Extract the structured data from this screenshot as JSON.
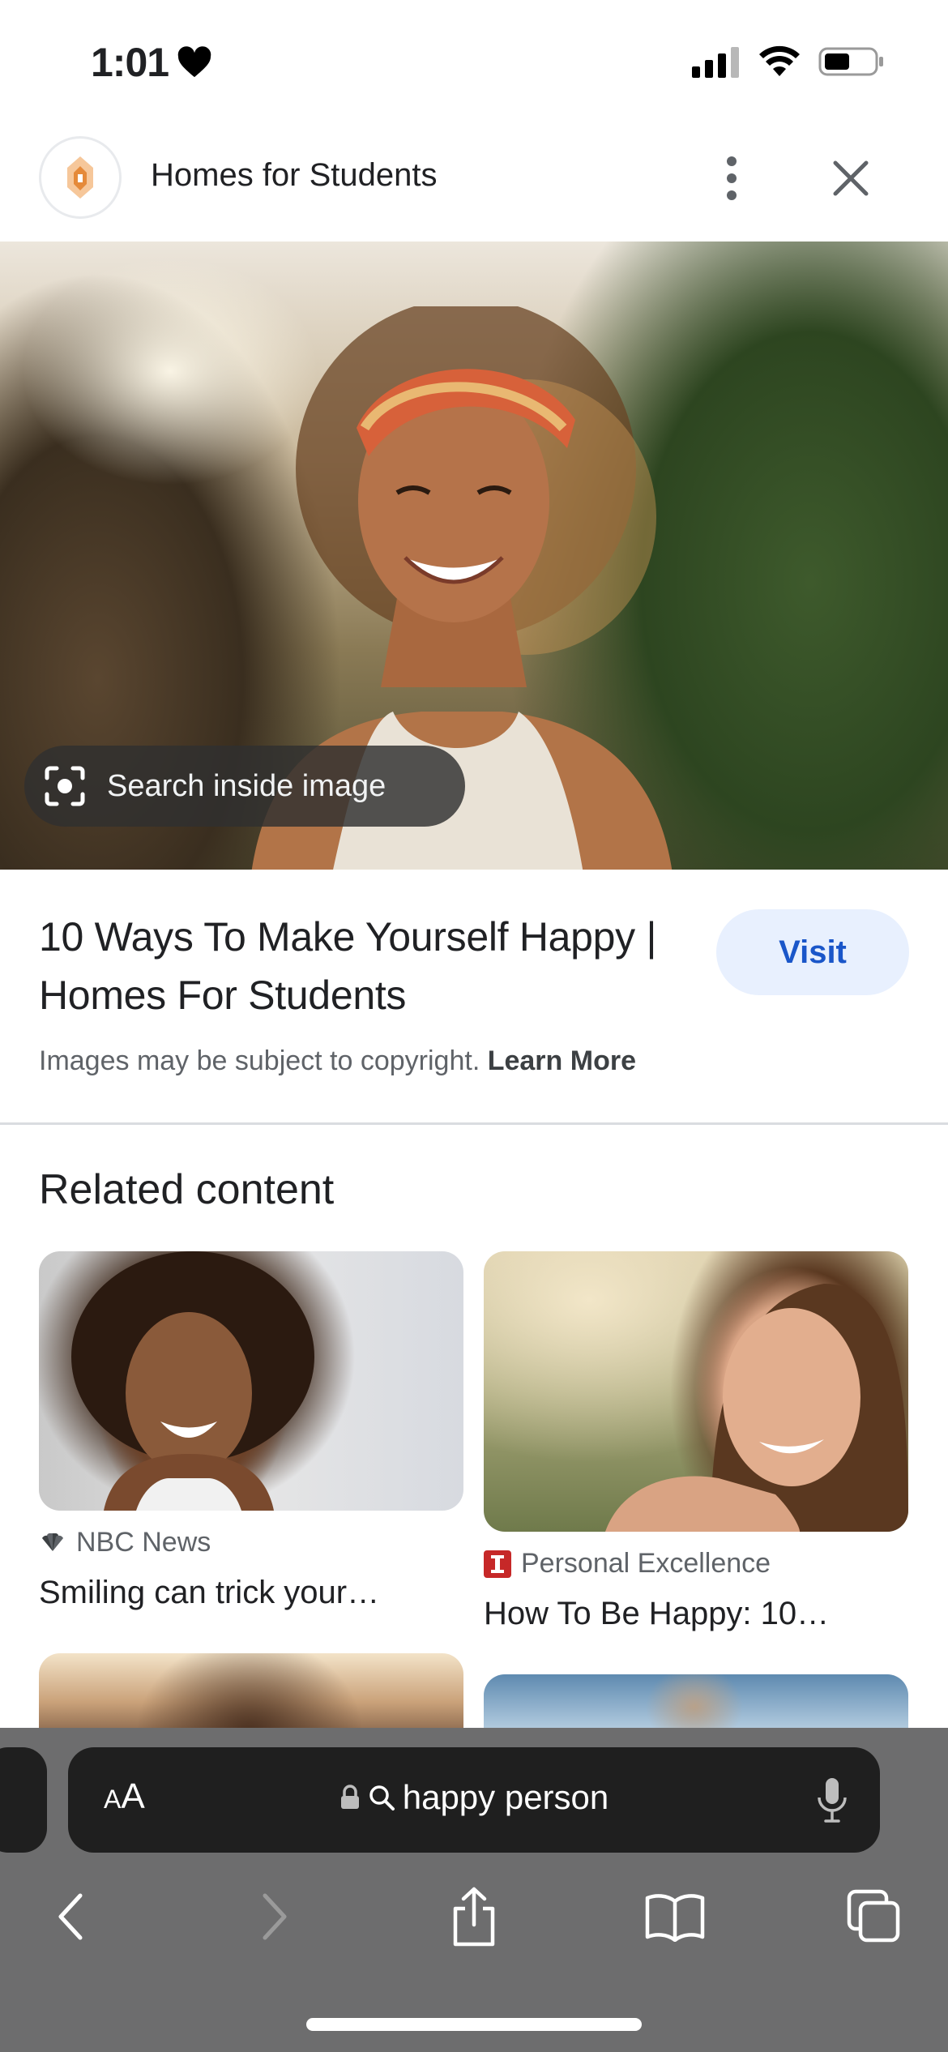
{
  "status_bar": {
    "time": "1:01",
    "icons": [
      "heart-icon",
      "signal-icon",
      "wifi-icon",
      "battery-icon"
    ]
  },
  "header": {
    "site_name": "Homes for Students",
    "icons": [
      "site-logo",
      "more-vert-icon",
      "close-icon"
    ]
  },
  "hero": {
    "search_inside_label": "Search inside image",
    "icon": "lens-icon"
  },
  "result": {
    "title": "10 Ways To Make Yourself Happy | Homes For Students",
    "visit_label": "Visit",
    "copyright_text": "Images may be subject to copyright.",
    "learn_more": "Learn More"
  },
  "related": {
    "heading": "Related content",
    "cards": [
      {
        "source": "NBC News",
        "source_icon": "nbc-peacock-icon",
        "title": "Smiling can trick your…"
      },
      {
        "source": "Personal Excellence",
        "source_icon": "personal-excellence-icon",
        "title": "How To Be Happy: 10…"
      }
    ]
  },
  "browser": {
    "aa_label_small": "A",
    "aa_label_large": "A",
    "url_text": "happy person",
    "icons": [
      "lock-icon",
      "search-icon",
      "mic-icon",
      "back-icon",
      "forward-icon",
      "share-icon",
      "bookmarks-icon",
      "tabs-icon"
    ]
  },
  "colors": {
    "visit_bg": "#e8f0fe",
    "visit_text": "#1a56c9",
    "safari_bar": "#6d6d6e",
    "address_bar": "#1f1f1f"
  }
}
